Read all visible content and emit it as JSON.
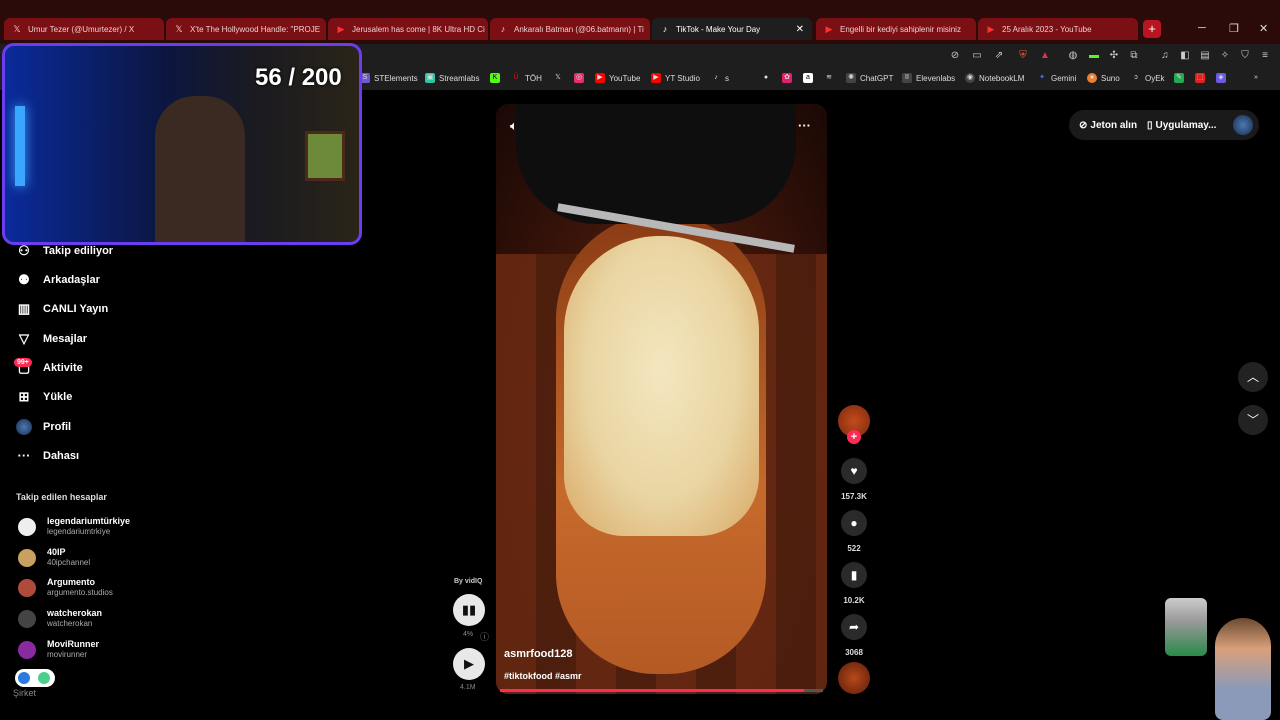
{
  "tabs": [
    {
      "label": "Umur Tezer (@Umurtezer) / X",
      "icon": "x-logo-icon",
      "active": false
    },
    {
      "label": "X'te The Hollywood Handle: \"PROJE",
      "icon": "x-logo-icon",
      "active": false
    },
    {
      "label": "Jerusalem has come | 8K Ultra HD Ci",
      "icon": "youtube-icon",
      "active": false
    },
    {
      "label": "Ankaralı Batman (@06.batmann) | Ti",
      "icon": "tiktok-icon",
      "active": false
    },
    {
      "label": "TikTok - Make Your Day",
      "icon": "tiktok-icon",
      "active": true,
      "close": "✕"
    },
    {
      "label": "Engelli bir kediyi sahiplenir misiniz",
      "icon": "youtube-icon",
      "active": false
    },
    {
      "label": "25 Aralık 2023 - YouTube",
      "icon": "youtube-icon",
      "active": false
    }
  ],
  "new_tab": "+",
  "window_controls": {
    "minimize": "─",
    "restore": "❐",
    "close": "✕"
  },
  "bookmarks": [
    {
      "label": "STElements",
      "icon": "stelements-icon",
      "color": "#6a5acd"
    },
    {
      "label": "Streamlabs",
      "icon": "streamlabs-icon",
      "color": "#31c3a2"
    },
    {
      "label": "",
      "icon": "kick-icon",
      "color": "#53fc18"
    },
    {
      "label": "TÖH",
      "icon": "toh-icon",
      "color": "#e0102a"
    },
    {
      "label": "",
      "icon": "x-logo-icon",
      "color": "#444"
    },
    {
      "label": "",
      "icon": "instagram-icon",
      "color": "#e1306c"
    },
    {
      "label": "YouTube",
      "icon": "youtube-icon",
      "color": "#ff0000"
    },
    {
      "label": "YT Studio",
      "icon": "yt-studio-icon",
      "color": "#ff0000"
    },
    {
      "label": "s",
      "icon": "tiktok-icon",
      "color": "#222"
    },
    {
      "label": "ChatGPT",
      "icon": "chatgpt-icon",
      "color": "#444"
    },
    {
      "label": "Elevenlabs",
      "icon": "elevenlabs-icon",
      "color": "#444"
    },
    {
      "label": "NotebookLM",
      "icon": "notebooklm-icon",
      "color": "#444"
    },
    {
      "label": "Gemini",
      "icon": "gemini-icon",
      "color": "#4a7ae8"
    },
    {
      "label": "Suno",
      "icon": "suno-icon",
      "color": "#f08030"
    },
    {
      "label": "OyEk",
      "icon": "oyek-icon",
      "color": "#444"
    }
  ],
  "counter": "56 / 200",
  "nav": [
    {
      "label": "Takip ediliyor",
      "icon": "following-icon"
    },
    {
      "label": "Arkadaşlar",
      "icon": "friends-icon"
    },
    {
      "label": "CANLI Yayın",
      "icon": "live-icon"
    },
    {
      "label": "Mesajlar",
      "icon": "messages-icon"
    },
    {
      "label": "Aktivite",
      "icon": "activity-icon"
    },
    {
      "label": "Yükle",
      "icon": "upload-icon"
    },
    {
      "label": "Profil",
      "icon": "profile-icon"
    },
    {
      "label": "Dahası",
      "icon": "more-icon"
    }
  ],
  "activity_badge": "99+",
  "followed_title": "Takip edilen hesaplar",
  "accounts": [
    {
      "name": "legendariumtürkiye",
      "handle": "legendariumtrkiye",
      "color": "#eee"
    },
    {
      "name": "40IP",
      "handle": "40ipchannel",
      "color": "#c8a060"
    },
    {
      "name": "Argumento",
      "handle": "argumento.studios",
      "color": "#b04a3a"
    },
    {
      "name": "watcherokan",
      "handle": "watcherokan",
      "color": "#444"
    },
    {
      "name": "MoviRunner",
      "handle": "movirunner",
      "color": "#8a2aa0"
    }
  ],
  "company_link": "Şirket",
  "video": {
    "author": "asmrfood128",
    "tags": "#tiktokfood #asmr",
    "progress": 0.94
  },
  "rail": {
    "likes": "157.3K",
    "comments": "522",
    "saves": "10.2K",
    "shares": "3068"
  },
  "vidiq": {
    "by": "By vidIQ",
    "percent": "4%",
    "views": "4.1M"
  },
  "top_right": {
    "coins": "Jeton alın",
    "app": "Uygulamay..."
  },
  "colors": {
    "accent": "#fe2c55",
    "tab_bar": "#2b0a0a",
    "tab": "#7a0f14",
    "webcam_border": "#6b3cf0"
  }
}
